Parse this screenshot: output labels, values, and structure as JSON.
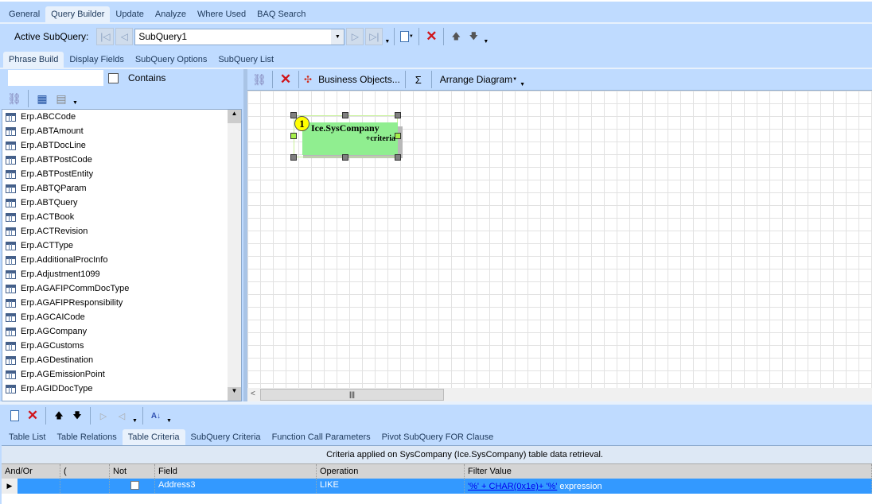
{
  "main_tabs": [
    "General",
    "Query Builder",
    "Update",
    "Analyze",
    "Where Used",
    "BAQ Search"
  ],
  "main_tab_active": 1,
  "subquery": {
    "label": "Active SubQuery:",
    "value": "SubQuery1"
  },
  "sub_tabs": [
    "Phrase Build",
    "Display Fields",
    "SubQuery Options",
    "SubQuery List"
  ],
  "search": {
    "value": "",
    "contains_label": "Contains"
  },
  "diagram_toolbar": {
    "business_objects": "Business Objects...",
    "sigma": "Σ",
    "arrange": "Arrange Diagram"
  },
  "tables": [
    "Erp.ABCCode",
    "Erp.ABTAmount",
    "Erp.ABTDocLine",
    "Erp.ABTPostCode",
    "Erp.ABTPostEntity",
    "Erp.ABTQParam",
    "Erp.ABTQuery",
    "Erp.ACTBook",
    "Erp.ACTRevision",
    "Erp.ACTType",
    "Erp.AdditionalProcInfo",
    "Erp.Adjustment1099",
    "Erp.AGAFIPCommDocType",
    "Erp.AGAFIPResponsibility",
    "Erp.AGCAICode",
    "Erp.AGCompany",
    "Erp.AGCustoms",
    "Erp.AGDestination",
    "Erp.AGEmissionPoint",
    "Erp.AGIDDocType"
  ],
  "diagram_node": {
    "number": "1",
    "name": "Ice.SysCompany",
    "note": "+criteria"
  },
  "bottom_tabs": [
    "Table List",
    "Table Relations",
    "Table Criteria",
    "SubQuery Criteria",
    "Function Call Parameters",
    "Pivot SubQuery FOR Clause"
  ],
  "bottom_tab_active": 2,
  "criteria": {
    "caption": "Criteria applied on SysCompany (Ice.SysCompany)  table data retrieval.",
    "columns": [
      "And/Or",
      "(",
      "Not",
      "Field",
      "Operation",
      "Filter Value"
    ],
    "rows": [
      {
        "and_or": "",
        "paren": "",
        "not": false,
        "field": "Address3",
        "operation": "LIKE",
        "filter_link": "'%' + CHAR(0x1e)+ '%'",
        "filter_suffix": "expression"
      }
    ]
  },
  "colors": {
    "bg": "#bfdbff",
    "selected": "#3399ff",
    "node": "#90ee90"
  }
}
